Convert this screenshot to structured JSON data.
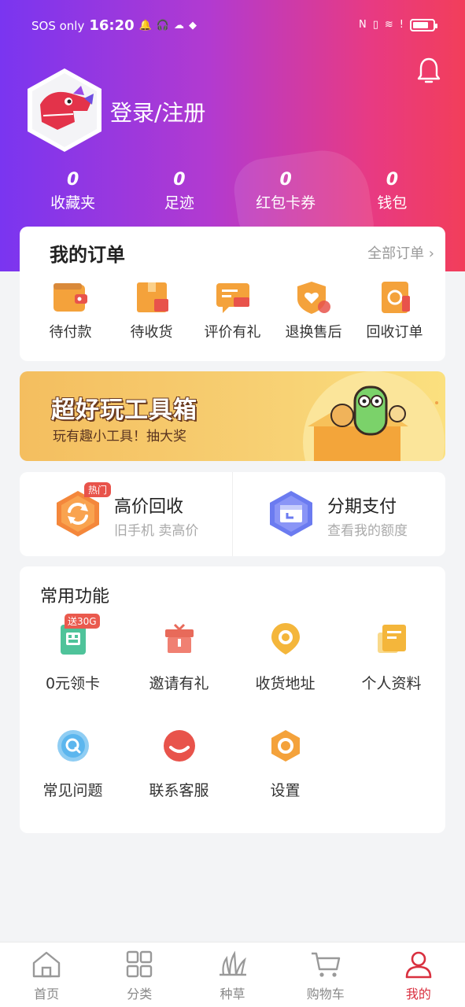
{
  "status_bar": {
    "carrier": "SOS only",
    "time": "16:20",
    "battery_level": 0.8
  },
  "header": {
    "login_label": "登录/注册"
  },
  "stats": [
    {
      "value": "0",
      "label": "收藏夹"
    },
    {
      "value": "0",
      "label": "足迹"
    },
    {
      "value": "0",
      "label": "红包卡券"
    },
    {
      "value": "0",
      "label": "钱包"
    }
  ],
  "orders": {
    "title": "我的订单",
    "all_label": "全部订单 ›",
    "items": [
      {
        "label": "待付款",
        "icon": "wallet-icon"
      },
      {
        "label": "待收货",
        "icon": "package-icon"
      },
      {
        "label": "评价有礼",
        "icon": "comment-icon"
      },
      {
        "label": "退换售后",
        "icon": "shield-heart-icon"
      },
      {
        "label": "回收订单",
        "icon": "recycle-doc-icon"
      }
    ]
  },
  "banner": {
    "title": "超好玩工具箱",
    "subtitle": "玩有趣小工具！抽大奖"
  },
  "promo": {
    "recycle": {
      "hot": "热门",
      "name": "高价回收",
      "sub": "旧手机 卖高价"
    },
    "installment": {
      "name": "分期支付",
      "sub": "查看我的额度"
    }
  },
  "functions": {
    "title": "常用功能",
    "items": [
      {
        "label": "0元领卡",
        "icon": "sim-card-icon",
        "badge": "送30G"
      },
      {
        "label": "邀请有礼",
        "icon": "gift-icon"
      },
      {
        "label": "收货地址",
        "icon": "location-pin-icon"
      },
      {
        "label": "个人资料",
        "icon": "profile-doc-icon"
      },
      {
        "label": "常见问题",
        "icon": "question-icon"
      },
      {
        "label": "联系客服",
        "icon": "customer-service-icon"
      },
      {
        "label": "设置",
        "icon": "settings-icon"
      }
    ]
  },
  "tabbar": {
    "items": [
      {
        "label": "首页",
        "icon": "home-icon"
      },
      {
        "label": "分类",
        "icon": "category-icon"
      },
      {
        "label": "种草",
        "icon": "grass-icon"
      },
      {
        "label": "购物车",
        "icon": "cart-icon"
      },
      {
        "label": "我的",
        "icon": "user-icon"
      }
    ],
    "active": "我的",
    "active_color": "#d9303f"
  },
  "colors": {
    "header_gradient_start": "#7a35f0",
    "header_gradient_end": "#f23e5a",
    "accent": "#d9303f"
  }
}
